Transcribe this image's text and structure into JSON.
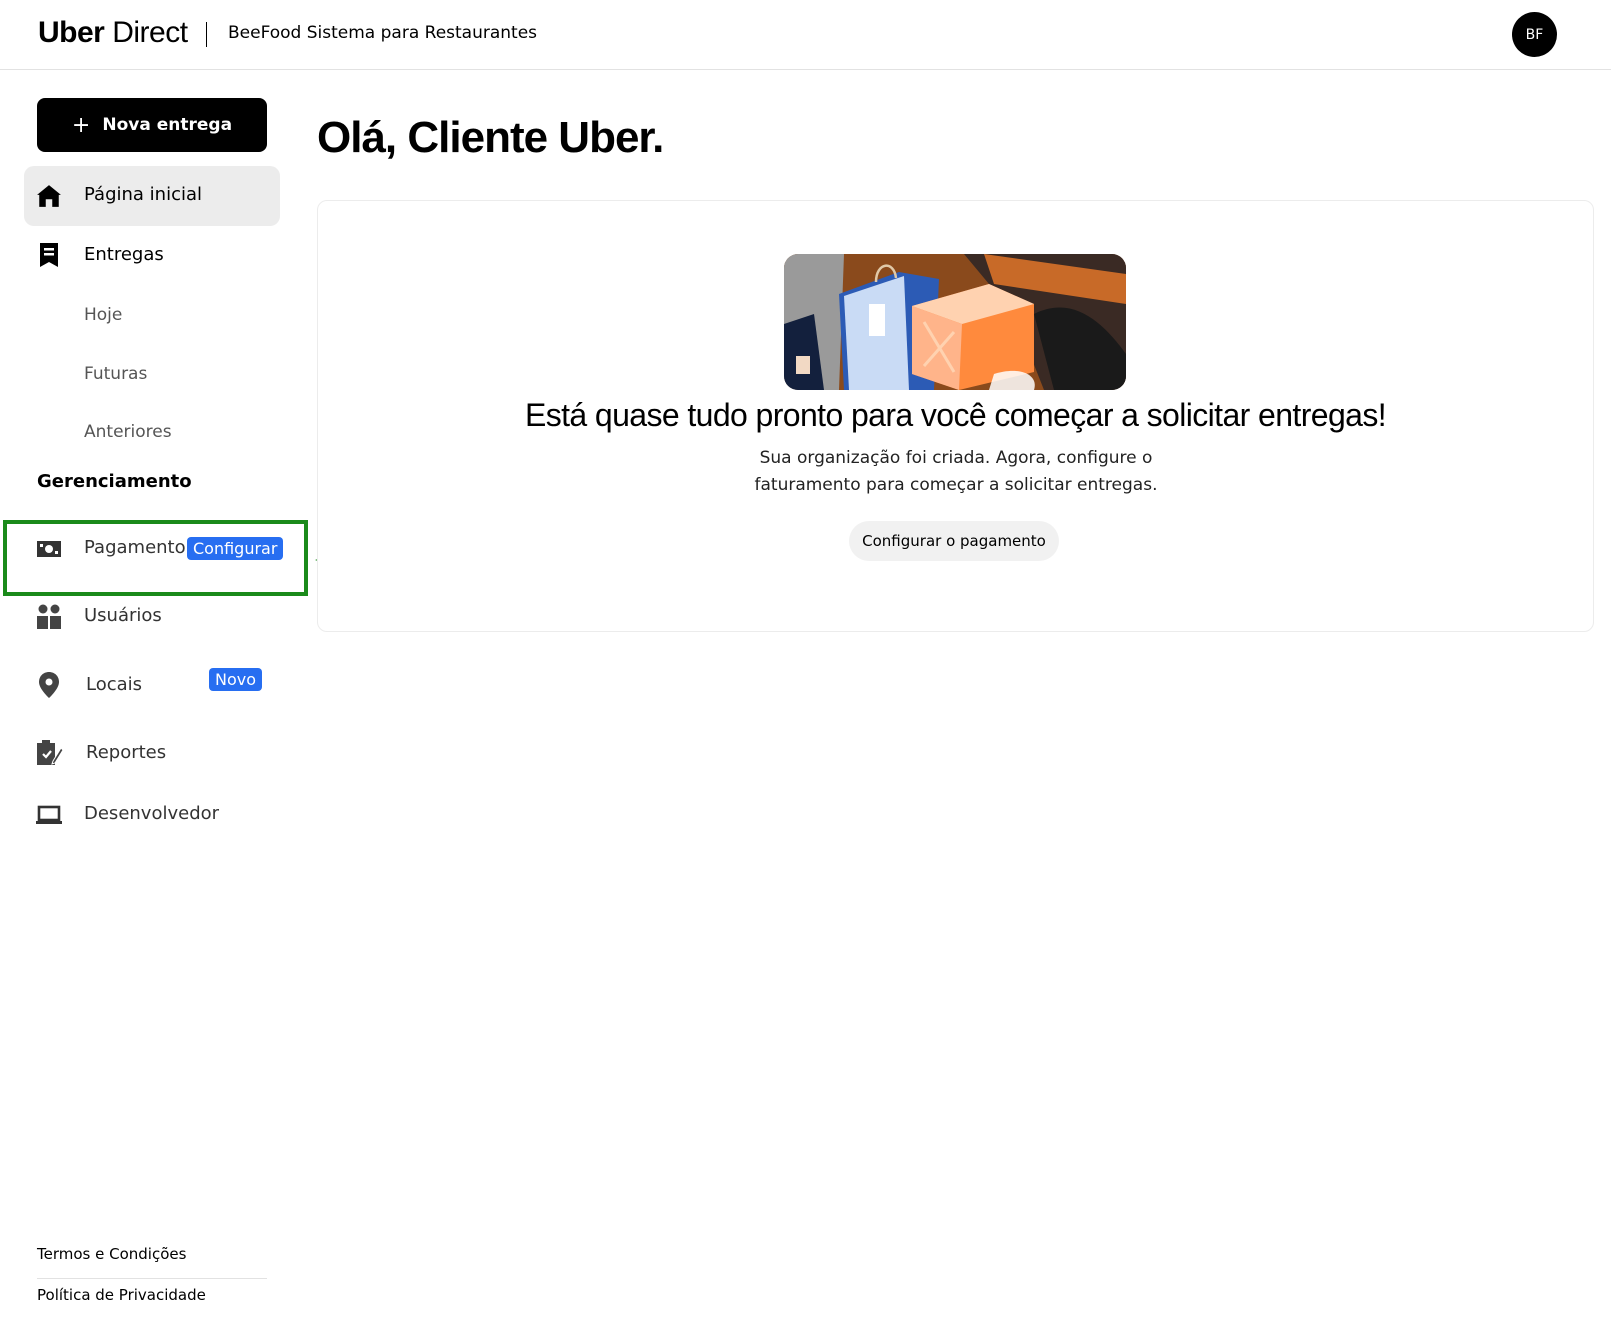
{
  "header": {
    "logo_bold": "Uber",
    "logo_light": " Direct",
    "org_name": "BeeFood Sistema para Restaurantes",
    "avatar_initials": "BF"
  },
  "sidebar": {
    "new_delivery_label": "Nova entrega",
    "items": {
      "home": "Página inicial",
      "deliveries": "Entregas",
      "today": "Hoje",
      "upcoming": "Futuras",
      "past": "Anteriores"
    },
    "section_title": "Gerenciamento",
    "management": {
      "payment": "Pagamento",
      "payment_badge": "Configurar",
      "users": "Usuários",
      "locations": "Locais",
      "locations_badge": "Novo",
      "reports": "Reportes",
      "developer": "Desenvolvedor"
    },
    "footer": {
      "terms": "Termos e Condições",
      "privacy": "Política de Privacidade"
    }
  },
  "main": {
    "greeting": "Olá, Cliente Uber.",
    "card": {
      "headline": "Está quase tudo pronto para você começar a solicitar entregas!",
      "description": "Sua organização foi criada. Agora, configure o faturamento para começar a solicitar entregas.",
      "button_label": "Configurar o pagamento"
    }
  },
  "colors": {
    "accent_blue": "#276ef1",
    "highlight_green": "#1a8a1a",
    "primary_black": "#000000"
  }
}
